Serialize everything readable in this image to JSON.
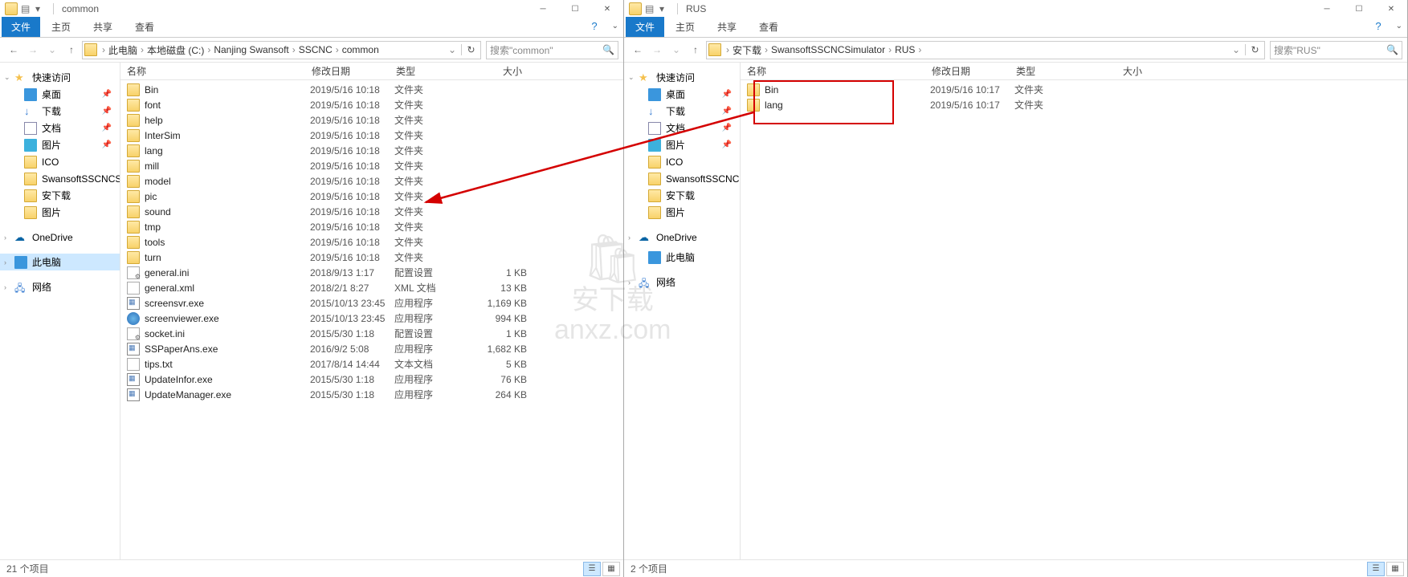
{
  "left": {
    "title": "common",
    "tabs": {
      "file": "文件",
      "home": "主页",
      "share": "共享",
      "view": "查看"
    },
    "breadcrumbs": [
      "此电脑",
      "本地磁盘 (C:)",
      "Nanjing Swansoft",
      "SSCNC",
      "common"
    ],
    "search_placeholder": "搜索\"common\"",
    "cols": {
      "name": "名称",
      "date": "修改日期",
      "type": "类型",
      "size": "大小"
    },
    "items": [
      {
        "name": "Bin",
        "date": "2019/5/16 10:18",
        "type": "文件夹",
        "size": "",
        "ic": "folder"
      },
      {
        "name": "font",
        "date": "2019/5/16 10:18",
        "type": "文件夹",
        "size": "",
        "ic": "folder"
      },
      {
        "name": "help",
        "date": "2019/5/16 10:18",
        "type": "文件夹",
        "size": "",
        "ic": "folder"
      },
      {
        "name": "InterSim",
        "date": "2019/5/16 10:18",
        "type": "文件夹",
        "size": "",
        "ic": "folder"
      },
      {
        "name": "lang",
        "date": "2019/5/16 10:18",
        "type": "文件夹",
        "size": "",
        "ic": "folder"
      },
      {
        "name": "mill",
        "date": "2019/5/16 10:18",
        "type": "文件夹",
        "size": "",
        "ic": "folder"
      },
      {
        "name": "model",
        "date": "2019/5/16 10:18",
        "type": "文件夹",
        "size": "",
        "ic": "folder"
      },
      {
        "name": "pic",
        "date": "2019/5/16 10:18",
        "type": "文件夹",
        "size": "",
        "ic": "folder"
      },
      {
        "name": "sound",
        "date": "2019/5/16 10:18",
        "type": "文件夹",
        "size": "",
        "ic": "folder"
      },
      {
        "name": "tmp",
        "date": "2019/5/16 10:18",
        "type": "文件夹",
        "size": "",
        "ic": "folder"
      },
      {
        "name": "tools",
        "date": "2019/5/16 10:18",
        "type": "文件夹",
        "size": "",
        "ic": "folder"
      },
      {
        "name": "turn",
        "date": "2019/5/16 10:18",
        "type": "文件夹",
        "size": "",
        "ic": "folder"
      },
      {
        "name": "general.ini",
        "date": "2018/9/13 1:17",
        "type": "配置设置",
        "size": "1 KB",
        "ic": "ini"
      },
      {
        "name": "general.xml",
        "date": "2018/2/1 8:27",
        "type": "XML 文档",
        "size": "13 KB",
        "ic": "xml"
      },
      {
        "name": "screensvr.exe",
        "date": "2015/10/13 23:45",
        "type": "应用程序",
        "size": "1,169 KB",
        "ic": "exe"
      },
      {
        "name": "screenviewer.exe",
        "date": "2015/10/13 23:45",
        "type": "应用程序",
        "size": "994 KB",
        "ic": "globe"
      },
      {
        "name": "socket.ini",
        "date": "2015/5/30 1:18",
        "type": "配置设置",
        "size": "1 KB",
        "ic": "ini"
      },
      {
        "name": "SSPaperAns.exe",
        "date": "2016/9/2 5:08",
        "type": "应用程序",
        "size": "1,682 KB",
        "ic": "exe"
      },
      {
        "name": "tips.txt",
        "date": "2017/8/14 14:44",
        "type": "文本文档",
        "size": "5 KB",
        "ic": "txt"
      },
      {
        "name": "UpdateInfor.exe",
        "date": "2015/5/30 1:18",
        "type": "应用程序",
        "size": "76 KB",
        "ic": "exe"
      },
      {
        "name": "UpdateManager.exe",
        "date": "2015/5/30 1:18",
        "type": "应用程序",
        "size": "264 KB",
        "ic": "exe"
      }
    ],
    "status": "21 个项目",
    "nav": {
      "quick": "快速访问",
      "desktop": "桌面",
      "downloads": "下载",
      "documents": "文档",
      "pictures": "图片",
      "ico": "ICO",
      "swansoft": "SwansoftSSCNCSi",
      "anxia": "安下载",
      "tupian": "图片",
      "onedrive": "OneDrive",
      "thispc": "此电脑",
      "network": "网络"
    }
  },
  "right": {
    "title": "RUS",
    "tabs": {
      "file": "文件",
      "home": "主页",
      "share": "共享",
      "view": "查看"
    },
    "breadcrumbs": [
      "安下载",
      "SwansoftSSCNCSimulator",
      "RUS"
    ],
    "search_placeholder": "搜索\"RUS\"",
    "cols": {
      "name": "名称",
      "date": "修改日期",
      "type": "类型",
      "size": "大小"
    },
    "items": [
      {
        "name": "Bin",
        "date": "2019/5/16 10:17",
        "type": "文件夹",
        "size": "",
        "ic": "folder"
      },
      {
        "name": "lang",
        "date": "2019/5/16 10:17",
        "type": "文件夹",
        "size": "",
        "ic": "folder"
      }
    ],
    "status": "2 个项目",
    "nav": {
      "quick": "快速访问",
      "desktop": "桌面",
      "downloads": "下载",
      "documents": "文档",
      "pictures": "图片",
      "ico": "ICO",
      "swansoft": "SwansoftSSCNC",
      "anxia": "安下载",
      "tupian": "图片",
      "onedrive": "OneDrive",
      "thispc": "此电脑",
      "network": "网络"
    }
  },
  "watermark": "anxz.com"
}
